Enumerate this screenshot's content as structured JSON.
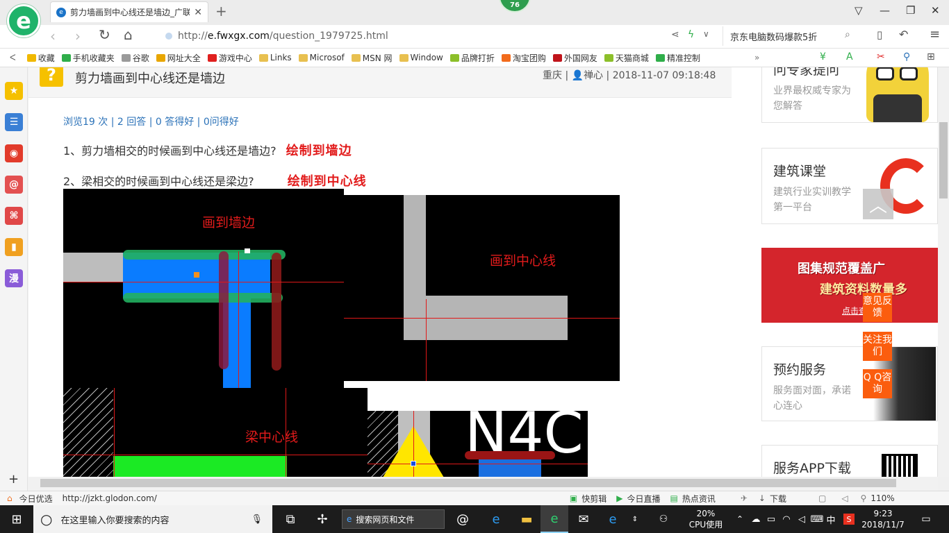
{
  "browser": {
    "tab_title": "剪力墙画到中心线还是墙边_广联",
    "badge": "76",
    "url_prefix": "http://",
    "url_domain": "e.fwxgx.com",
    "url_path": "/question_1979725.html",
    "search_text": "京东电脑数码爆款5折"
  },
  "bookmarks": [
    {
      "label": "收藏",
      "color": "#f0b800"
    },
    {
      "label": "手机收藏夹",
      "color": "#2fae4a"
    },
    {
      "label": "谷歌",
      "color": "#9a9a9a"
    },
    {
      "label": "网址大全",
      "color": "#e8a600"
    },
    {
      "label": "游戏中心",
      "color": "#e0201f"
    },
    {
      "label": "Links",
      "color": "#e8c050"
    },
    {
      "label": "Microsof",
      "color": "#e8c050"
    },
    {
      "label": "MSN 网",
      "color": "#e8c050"
    },
    {
      "label": "Window",
      "color": "#e8c050"
    },
    {
      "label": "品牌打折",
      "color": "#8cbf2a"
    },
    {
      "label": "淘宝团购",
      "color": "#f26b1c"
    },
    {
      "label": "外国网友",
      "color": "#c0141b"
    },
    {
      "label": "天猫商城",
      "color": "#8cbf2a"
    },
    {
      "label": "精准控制",
      "color": "#2fae4a"
    }
  ],
  "sidebar_icons": [
    {
      "name": "star-icon",
      "glyph": "★",
      "color": "#f5c000"
    },
    {
      "name": "news-icon",
      "glyph": "☰",
      "color": "#3a7fd5"
    },
    {
      "name": "weibo-icon",
      "glyph": "◉",
      "color": "#e23b2b"
    },
    {
      "name": "mail-icon",
      "glyph": "@",
      "color": "#e35050"
    },
    {
      "name": "game-icon",
      "glyph": "⌘",
      "color": "#e04848"
    },
    {
      "name": "book-icon",
      "glyph": "▮",
      "color": "#f0a020"
    },
    {
      "name": "comic-icon",
      "glyph": "漫",
      "color": "#8a5cd8"
    }
  ],
  "question": {
    "title": "剪力墙画到中心线还是墙边",
    "location": "重庆",
    "author": "禅心",
    "datetime": "2018-11-07 09:18:48",
    "stats": "浏览19 次 | 2 回答 | 0 答得好 | 0问得好",
    "line1": "1、剪力墙相交的时候画到中心线还是墙边?",
    "answer1": "绘制到墙边",
    "line2": "2、梁相交的时候画到中心线还是梁边?",
    "answer2": "绘制到中心线"
  },
  "cad_labels": {
    "img1": "画到墙边",
    "img2": "画到中心线",
    "img3": "梁中心线",
    "img4": "N4C"
  },
  "right_cards": [
    {
      "title": "问专家提问",
      "subtitle": "业界最权威专家为您解答"
    },
    {
      "title": "建筑课堂",
      "subtitle": "建筑行业实训教学第一平台"
    },
    {
      "title": "预约服务",
      "subtitle": "服务面对面，承诺心连心"
    },
    {
      "title": "服务APP下载",
      "subtitle": ""
    }
  ],
  "banner": {
    "line1": "图集规范覆盖广",
    "line2": "建筑资料数量多",
    "cta": "点击查看"
  },
  "float_buttons": {
    "feedback": "意见反馈",
    "follow": "关注我们",
    "qq": "Q Q咨询"
  },
  "status_bar": {
    "left_label": "今日优选",
    "url": "http://jzkt.glodon.com/",
    "items": [
      "快剪辑",
      "今日直播",
      "热点资讯",
      "下载"
    ],
    "zoom": "110%"
  },
  "taskbar": {
    "search_placeholder": "在这里输入你要搜索的内容",
    "web_search": "搜索网页和文件",
    "cpu_percent": "20%",
    "cpu_label": "CPU使用",
    "ime": "中",
    "time": "9:23",
    "date": "2018/11/7"
  }
}
